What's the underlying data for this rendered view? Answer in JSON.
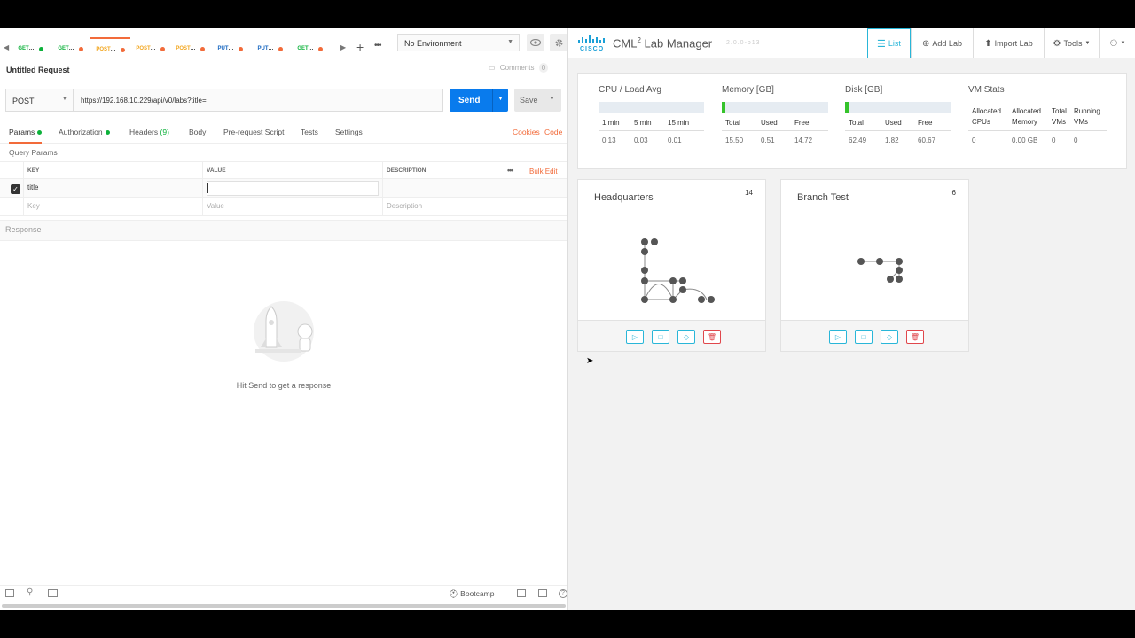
{
  "postman": {
    "tabs": [
      {
        "method": "GET",
        "label": "GET",
        "dot": "#0cb13a"
      },
      {
        "method": "GET",
        "label": "GET",
        "dot": "#f26b3a"
      },
      {
        "method": "POST",
        "label": "POST",
        "dot": "#f26b3a",
        "active": true
      },
      {
        "method": "POST",
        "label": "POST",
        "dot": "#f26b3a"
      },
      {
        "method": "POST",
        "label": "POST",
        "dot": "#f26b3a"
      },
      {
        "method": "PUT",
        "label": "PUT",
        "dot": "#f26b3a"
      },
      {
        "method": "PUT",
        "label": "PUT",
        "dot": "#f26b3a"
      },
      {
        "method": "GET",
        "label": "GET",
        "dot": "#f26b3a"
      }
    ],
    "environment": "No Environment",
    "request_title": "Untitled Request",
    "comments_label": "Comments",
    "comments_count": "0",
    "method": "POST",
    "url": "https://192.168.10.229/api/v0/labs?title=",
    "send_label": "Send",
    "save_label": "Save",
    "subtabs": {
      "params": "Params",
      "authorization": "Authorization",
      "headers": "Headers",
      "headers_count": "(9)",
      "body": "Body",
      "prerequest": "Pre-request Script",
      "tests": "Tests",
      "settings": "Settings"
    },
    "cookies": "Cookies",
    "code": "Code",
    "query_params_title": "Query Params",
    "table": {
      "headers": [
        "KEY",
        "VALUE",
        "DESCRIPTION"
      ],
      "bulk_edit": "Bulk Edit",
      "row_key": "title",
      "row_value": "",
      "placeholder_key": "Key",
      "placeholder_value": "Value",
      "placeholder_description": "Description"
    },
    "response_label": "Response",
    "response_hint": "Hit Send to get a response",
    "footer_bootcamp": "Bootcamp",
    "accent": "#f26b3a",
    "send_color": "#097bed"
  },
  "cml": {
    "title": "CML",
    "title_sup": "2",
    "title_rest": "Lab Manager",
    "version": "2.0.0-b13",
    "nav": {
      "list": "List",
      "add_lab": "Add Lab",
      "import_lab": "Import Lab",
      "tools": "Tools"
    },
    "stats": {
      "cpu": {
        "title": "CPU / Load Avg",
        "headers": [
          "1 min",
          "5 min",
          "15 min"
        ],
        "values": [
          "0.13",
          "0.03",
          "0.01"
        ]
      },
      "memory": {
        "title": "Memory [GB]",
        "headers": [
          "Total",
          "Used",
          "Free"
        ],
        "values": [
          "15.50",
          "0.51",
          "14.72"
        ],
        "usage": 0.03
      },
      "disk": {
        "title": "Disk [GB]",
        "headers": [
          "Total",
          "Used",
          "Free"
        ],
        "values": [
          "62.49",
          "1.82",
          "60.67"
        ],
        "usage": 0.03
      },
      "vm": {
        "title": "VM Stats",
        "headers": [
          [
            "Allocated",
            "CPUs"
          ],
          [
            "Allocated",
            "Memory"
          ],
          [
            "Total",
            "VMs"
          ],
          [
            "Running",
            "VMs"
          ]
        ],
        "values": [
          "0",
          "0.00 GB",
          "0",
          "0"
        ]
      }
    },
    "labs": [
      {
        "name": "Headquarters",
        "nodes": "14"
      },
      {
        "name": "Branch Test",
        "nodes": "6"
      }
    ],
    "accent": "#29b6d8",
    "danger": "#e0474c"
  }
}
